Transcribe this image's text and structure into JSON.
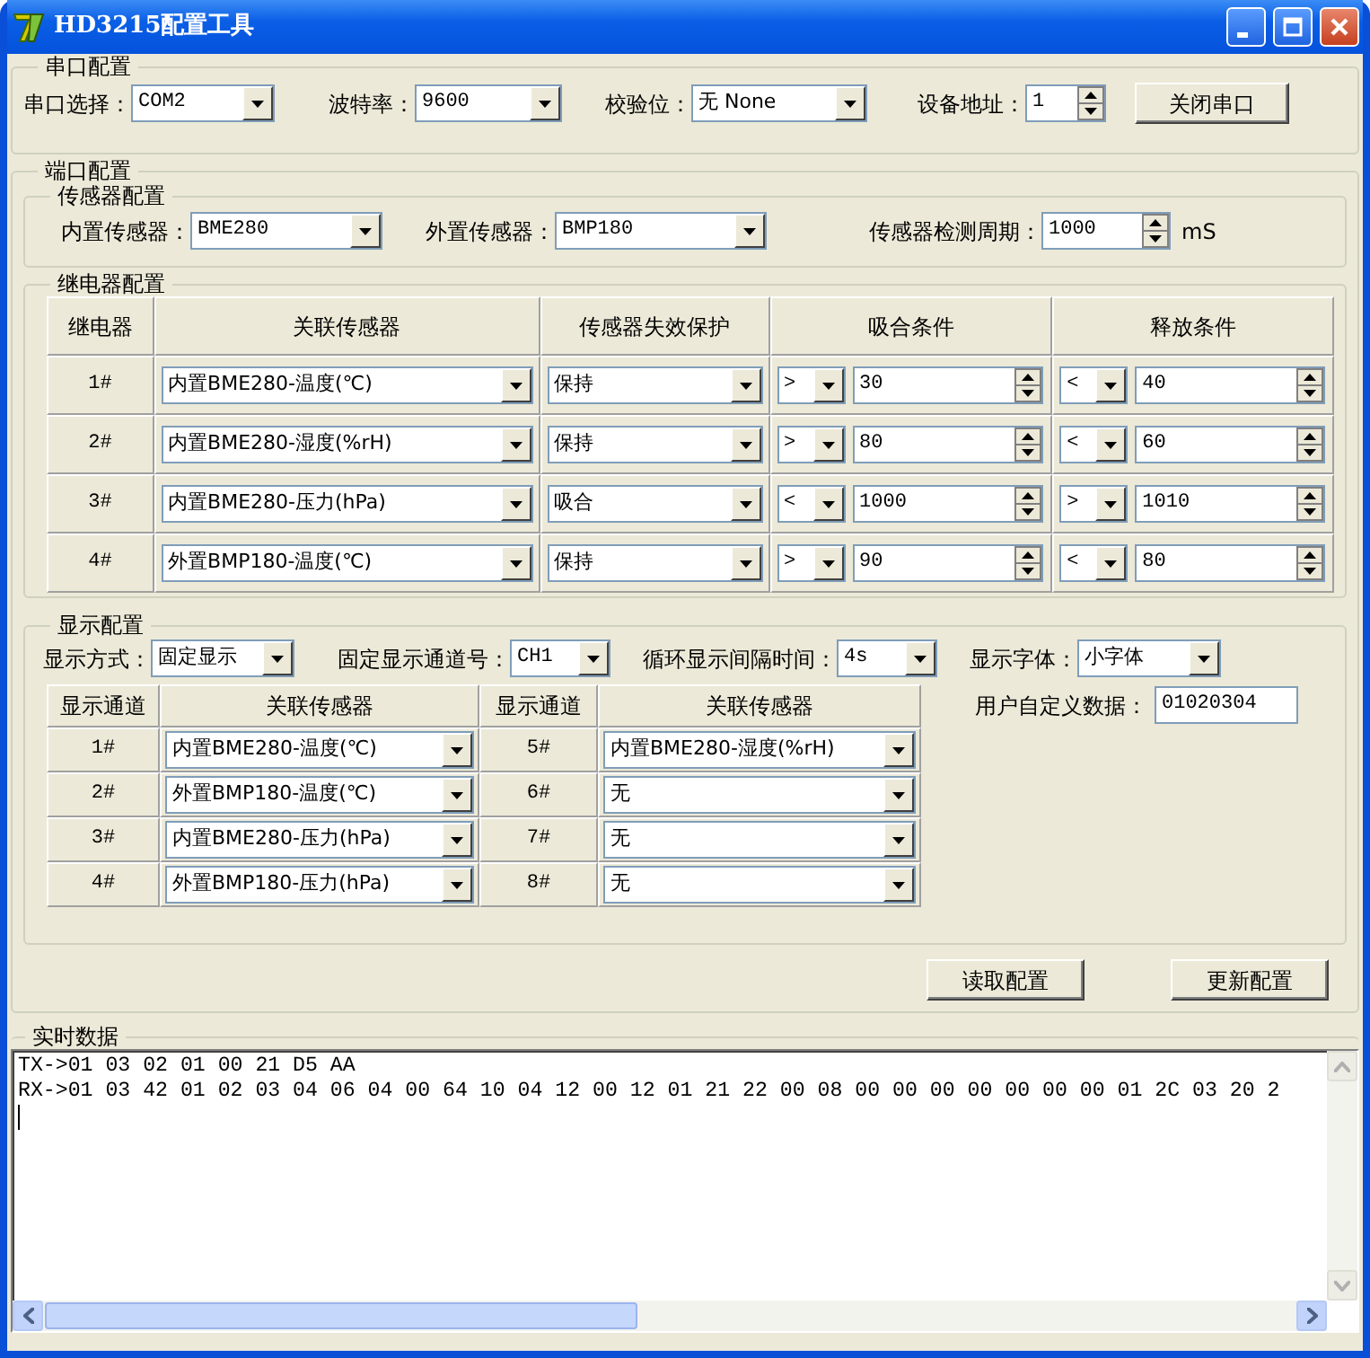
{
  "window": {
    "title": "HD3215配置工具"
  },
  "serial": {
    "title": "串口配置",
    "fields": [
      {
        "label": "串口选择：",
        "kind": "select",
        "value": "COM2"
      },
      {
        "label": "波特率：",
        "kind": "select",
        "value": "9600"
      },
      {
        "label": "校验位：",
        "kind": "select",
        "value": "无 None"
      },
      {
        "label": "设备地址：",
        "kind": "spin",
        "value": "1"
      }
    ],
    "button": "关闭串口"
  },
  "port": {
    "title": "端口配置",
    "sensors": {
      "title": "传感器配置",
      "fields": [
        {
          "label": "内置传感器：",
          "kind": "select",
          "value": "BME280"
        },
        {
          "label": "外置传感器：",
          "kind": "select",
          "value": "BMP180"
        },
        {
          "label": "传感器检测周期：",
          "kind": "spin",
          "value": "1000"
        }
      ],
      "unit": "mS"
    },
    "relays": {
      "title": "继电器配置",
      "columns": [
        "继电器",
        "关联传感器",
        "传感器失效保护",
        "吸合条件",
        "释放条件"
      ],
      "rows": [
        {
          "relay": "1#",
          "sensor": "内置BME280-温度(℃)",
          "failsafe": "保持",
          "pull_op": ">",
          "pull_value": "30",
          "release_op": "<",
          "release_value": "40"
        },
        {
          "relay": "2#",
          "sensor": "内置BME280-湿度(%rH)",
          "failsafe": "保持",
          "pull_op": ">",
          "pull_value": "80",
          "release_op": "<",
          "release_value": "60"
        },
        {
          "relay": "3#",
          "sensor": "内置BME280-压力(hPa)",
          "failsafe": "吸合",
          "pull_op": "<",
          "pull_value": "1000",
          "release_op": ">",
          "release_value": "1010"
        },
        {
          "relay": "4#",
          "sensor": "外置BMP180-温度(℃)",
          "failsafe": "保持",
          "pull_op": ">",
          "pull_value": "90",
          "release_op": "<",
          "release_value": "80"
        }
      ]
    },
    "display": {
      "title": "显示配置",
      "fields": [
        {
          "label": "显示方式：",
          "value": "固定显示"
        },
        {
          "label": "固定显示通道号：",
          "value": "CH1"
        },
        {
          "label": "循环显示间隔时间：",
          "value": "4s"
        },
        {
          "label": "显示字体：",
          "value": "小字体"
        }
      ],
      "columns": [
        "显示通道",
        "关联传感器",
        "显示通道",
        "关联传感器"
      ],
      "channels": [
        {
          "channel": "1#",
          "sensor": "内置BME280-温度(℃)"
        },
        {
          "channel": "2#",
          "sensor": "外置BMP180-温度(℃)"
        },
        {
          "channel": "3#",
          "sensor": "内置BME280-压力(hPa)"
        },
        {
          "channel": "4#",
          "sensor": "外置BMP180-压力(hPa)"
        },
        {
          "channel": "5#",
          "sensor": "内置BME280-湿度(%rH)"
        },
        {
          "channel": "6#",
          "sensor": "无"
        },
        {
          "channel": "7#",
          "sensor": "无"
        },
        {
          "channel": "8#",
          "sensor": "无"
        }
      ],
      "custom": {
        "label": "用户自定义数据：",
        "value": "01020304"
      }
    },
    "buttons": [
      "读取配置",
      "更新配置"
    ]
  },
  "log": {
    "title": "实时数据",
    "lines": [
      "TX->01 03 02 01 00 21 D5 AA",
      "RX->01 03 42 01 02 03 04 06 04 00 64 10 04 12 00 12 01 21 22 00 08 00 00 00 00 00 00 00 01 2C 03 20 2"
    ]
  }
}
